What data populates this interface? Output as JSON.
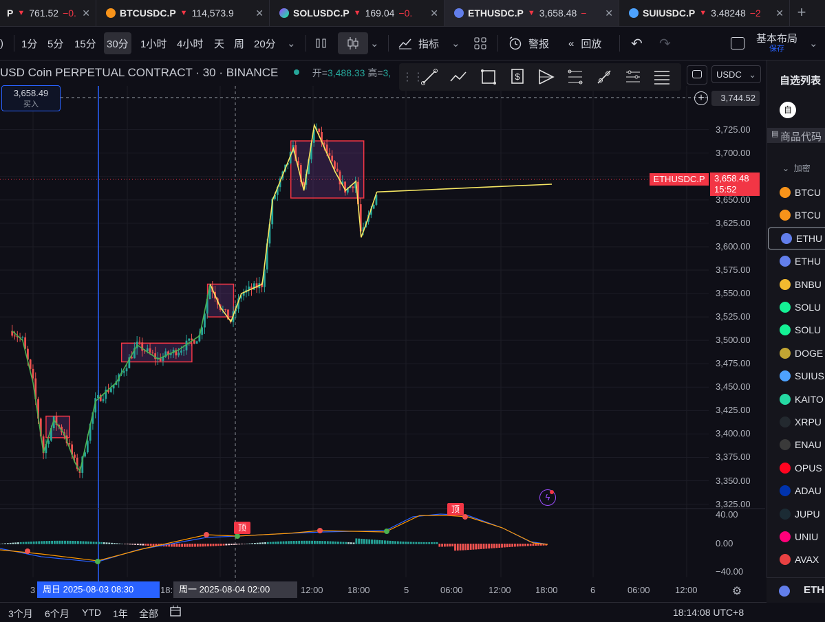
{
  "tabs": [
    {
      "symbol": "P",
      "price": "761.52",
      "change": "−0.",
      "active": false
    },
    {
      "symbol": "BTCUSDC.P",
      "price": "114,573.9",
      "change": "",
      "active": false
    },
    {
      "symbol": "SOLUSDC.P",
      "price": "169.04",
      "change": "−0.",
      "active": false
    },
    {
      "symbol": "ETHUSDC.P",
      "price": "3,658.48",
      "change": "−",
      "active": true
    },
    {
      "symbol": "SUIUSDC.P",
      "price": "3.48248",
      "change": "−2",
      "active": false
    }
  ],
  "toolbar": {
    "intervals": [
      "1分",
      "5分",
      "15分",
      "30分",
      "1小时",
      "4小时",
      "天",
      "周",
      "20分"
    ],
    "selected_interval": "30分",
    "indicators_label": "指标",
    "alert_label": "警报",
    "replay_label": "回放",
    "layout_label": "基本布局",
    "save_label": "保存",
    "leading_glyph": ")"
  },
  "legend": {
    "title": "USD Coin PERPETUAL CONTRACT · 30 · BINANCE",
    "open_label": "开=",
    "open_value": "3,488.33",
    "high_label": "高=",
    "high_value": "3,"
  },
  "order": {
    "price": "3,658.49",
    "label": "买入"
  },
  "currency_select": "USDC",
  "high_line_label": "3,744.52",
  "current_price": {
    "symbol_tag": "ETHUSDC.P",
    "price": "3,658.48",
    "countdown": "15:52"
  },
  "price_ticks": [
    "3,725.00",
    "3,700.00",
    "3,675.00",
    "3,650.00",
    "3,625.00",
    "3,600.00",
    "3,575.00",
    "3,550.00",
    "3,525.00",
    "3,500.00",
    "3,475.00",
    "3,450.00",
    "3,425.00",
    "3,400.00",
    "3,375.00",
    "3,350.00",
    "3,325.00"
  ],
  "macd_ticks": [
    "40.00",
    "0.00",
    "−40.00"
  ],
  "macd_marks": [
    "顶",
    "顶"
  ],
  "time_ticks": [
    "3",
    "18:",
    "12:00",
    "18:00",
    "5",
    "06:00",
    "12:00",
    "18:00",
    "6",
    "06:00",
    "12:00"
  ],
  "time_selected_1": "周日 2025-08-03   08:30",
  "time_selected_2": "周一 2025-08-04   02:00",
  "bottom": {
    "ranges": [
      "3个月",
      "6个月",
      "YTD",
      "1年",
      "全部"
    ],
    "clock": "18:14:08 UTC+8"
  },
  "watchlist": {
    "title": "自选列表",
    "list_button": "自",
    "column_header": "商品代码",
    "section": "加密",
    "items": [
      "BTCU",
      "BTCU",
      "ETHU",
      "ETHU",
      "BNBU",
      "SOLU",
      "SOLU",
      "DOGE",
      "SUIUS",
      "KAITO",
      "XRPU",
      "ENAU",
      "OPUS",
      "ADAU",
      "JUPU",
      "UNIU",
      "AVAX"
    ],
    "selected_index": 2,
    "footer_symbol": "ETH"
  },
  "colors": {
    "up": "#26a69a",
    "down": "#ef5350",
    "accent": "#2962ff",
    "zigzag_green": "#4caf50",
    "zigzag_yellow": "#f5e663",
    "box_red": "#f23645"
  },
  "chart_data": {
    "type": "candlestick",
    "symbol": "ETHUSDC.P",
    "interval": "30",
    "ylim": [
      3310,
      3760
    ],
    "x_range": [
      "2025-08-02 20:00",
      "2025-08-06 12:00"
    ],
    "price_path": [
      [
        "2025-08-02 20:00",
        3510
      ],
      [
        "2025-08-02 22:00",
        3500
      ],
      [
        "2025-08-03 00:00",
        3455
      ],
      [
        "2025-08-03 02:00",
        3380
      ],
      [
        "2025-08-03 04:00",
        3415
      ],
      [
        "2025-08-03 06:00",
        3400
      ],
      [
        "2025-08-03 08:00",
        3370
      ],
      [
        "2025-08-03 09:00",
        3360
      ],
      [
        "2025-08-03 12:00",
        3435
      ],
      [
        "2025-08-03 16:00",
        3455
      ],
      [
        "2025-08-03 20:00",
        3495
      ],
      [
        "2025-08-04 00:00",
        3480
      ],
      [
        "2025-08-04 04:00",
        3490
      ],
      [
        "2025-08-04 08:00",
        3505
      ],
      [
        "2025-08-04 10:00",
        3560
      ],
      [
        "2025-08-04 12:00",
        3535
      ],
      [
        "2025-08-04 14:00",
        3520
      ],
      [
        "2025-08-04 16:00",
        3550
      ],
      [
        "2025-08-04 20:00",
        3560
      ],
      [
        "2025-08-04 22:00",
        3650
      ],
      [
        "2025-08-05 02:00",
        3705
      ],
      [
        "2025-08-05 04:00",
        3660
      ],
      [
        "2025-08-05 06:00",
        3730
      ],
      [
        "2025-08-05 08:00",
        3705
      ],
      [
        "2025-08-05 10:00",
        3680
      ],
      [
        "2025-08-05 12:00",
        3660
      ],
      [
        "2025-08-05 14:00",
        3670
      ],
      [
        "2025-08-05 15:00",
        3610
      ],
      [
        "2025-08-05 16:00",
        3625
      ],
      [
        "2025-08-05 18:00",
        3658.48
      ]
    ],
    "zones": [
      {
        "from": "2025-08-03 02:30",
        "to": "2025-08-03 07:00",
        "low": 3396,
        "high": 3419
      },
      {
        "from": "2025-08-03 17:00",
        "to": "2025-08-04 06:30",
        "low": 3477,
        "high": 3497
      },
      {
        "from": "2025-08-04 09:30",
        "to": "2025-08-04 14:30",
        "low": 3525,
        "high": 3560
      },
      {
        "from": "2025-08-05 01:30",
        "to": "2025-08-05 15:30",
        "low": 3652,
        "high": 3713
      }
    ],
    "high_line": 3744.52,
    "order_line": 3658.49,
    "last_price": 3658.48,
    "macd_range": [
      -40,
      40
    ]
  }
}
